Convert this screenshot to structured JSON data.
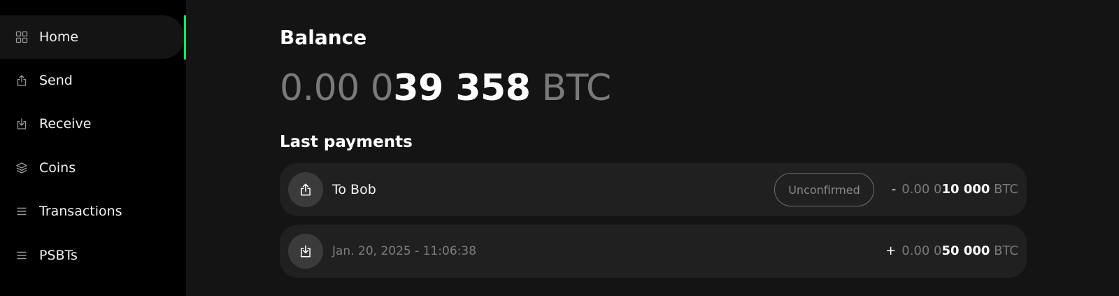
{
  "sidebar": {
    "items": [
      {
        "label": "Home",
        "icon": "grid-icon",
        "active": true
      },
      {
        "label": "Send",
        "icon": "send-icon"
      },
      {
        "label": "Receive",
        "icon": "receive-icon"
      },
      {
        "label": "Coins",
        "icon": "layers-icon"
      },
      {
        "label": "Transactions",
        "icon": "list-icon"
      },
      {
        "label": "PSBTs",
        "icon": "list-icon"
      }
    ],
    "active_color": "#00ff66"
  },
  "main": {
    "title": "Balance",
    "balance": {
      "dim": "0.00 0",
      "bold": "39 358",
      "unit": "BTC"
    },
    "subtitle": "Last payments",
    "payments": [
      {
        "icon": "send-icon",
        "label": "To Bob",
        "status": "Unconfirmed",
        "sign": "-",
        "amount_dim": "0.00 0",
        "amount_bold": "10 000",
        "unit": "BTC"
      },
      {
        "icon": "receive-icon",
        "label": "Jan. 20, 2025 - 11:06:38",
        "status": "",
        "sign": "+",
        "amount_dim": "0.00 0",
        "amount_bold": "50 000",
        "unit": "BTC"
      }
    ]
  }
}
